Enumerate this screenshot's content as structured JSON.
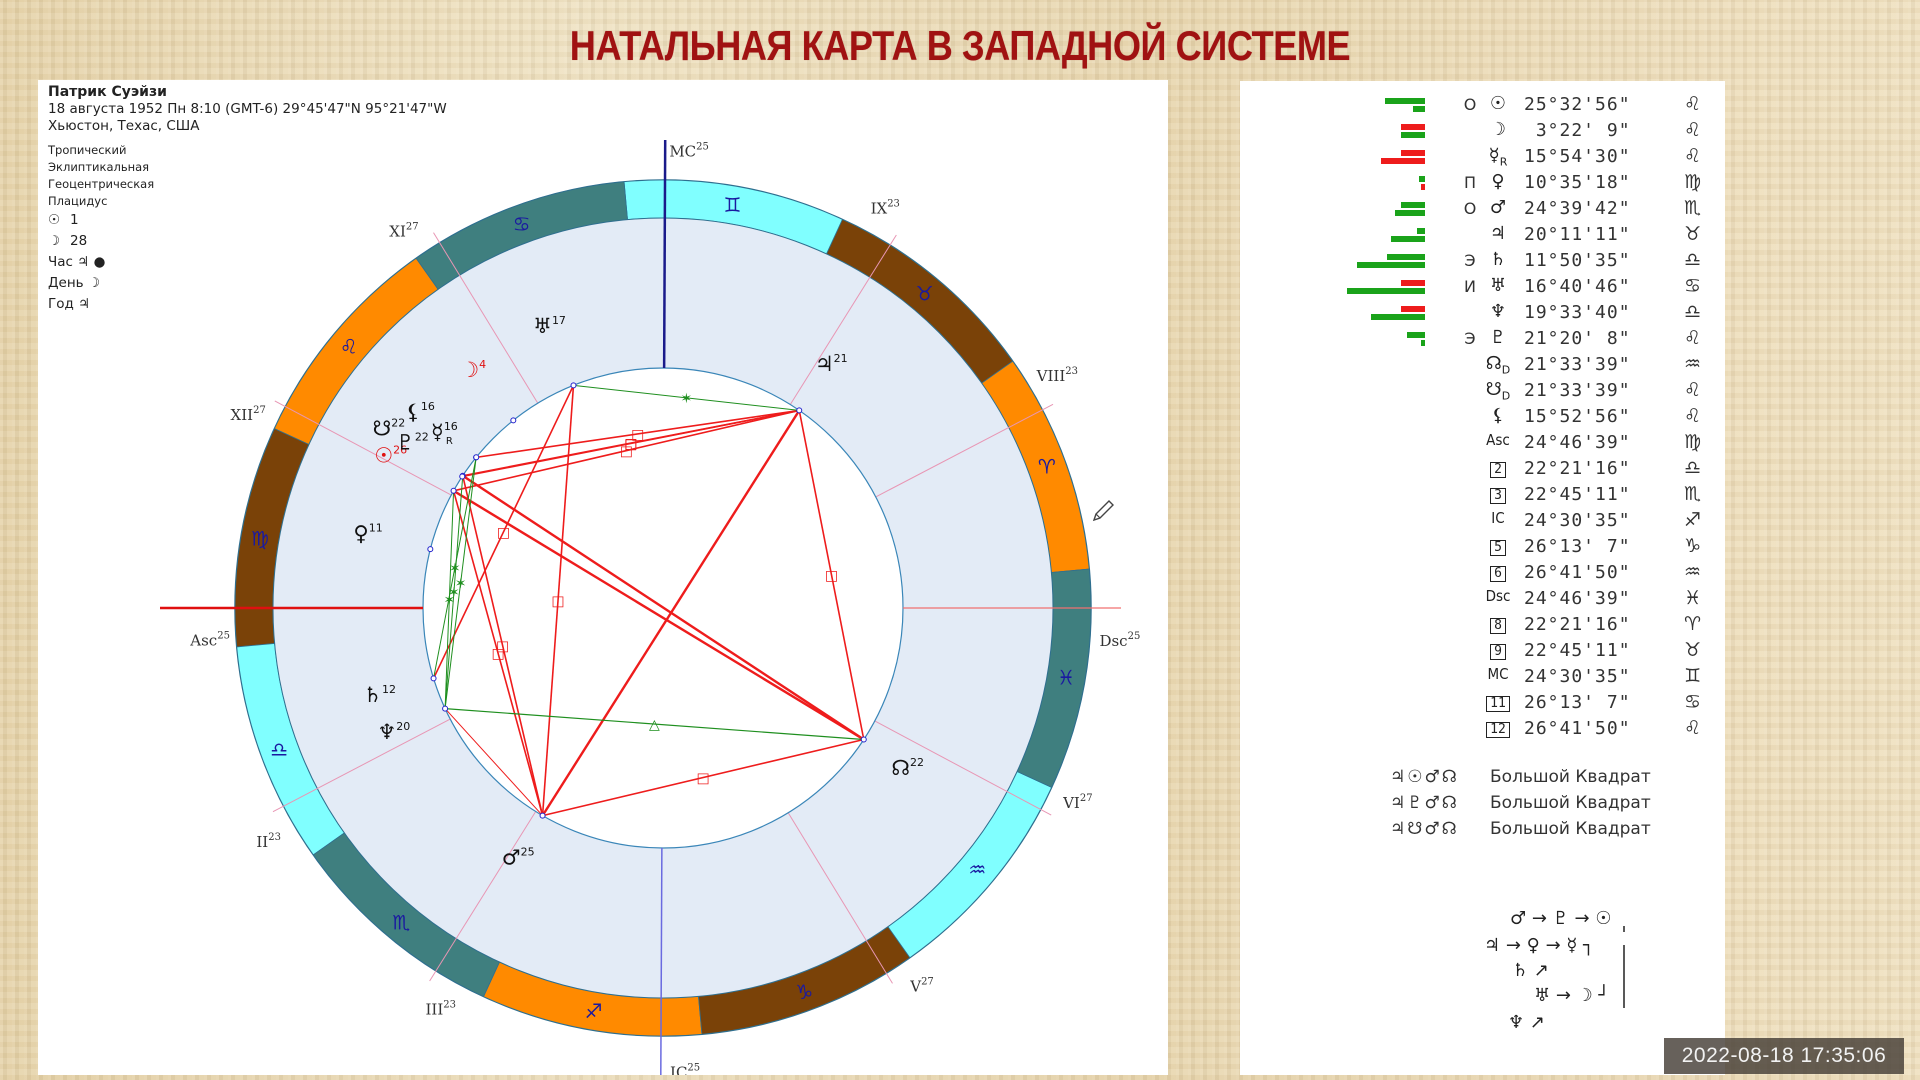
{
  "title": "НАТАЛЬНАЯ КАРТА В ЗАПАДНОЙ СИСТЕМЕ",
  "person": {
    "name": "Патрик Суэйзи",
    "birth_line": "18 августа 1952  Пн   8:10 (GMT-6) 29°45'47\"N  95°21'47\"W",
    "place": "Хьюстон, Техас, США"
  },
  "settings": [
    "Тропический",
    "Эклиптикальная",
    "Геоцентрическая",
    "Плацидус"
  ],
  "rulers": [
    {
      "glyph": "☉",
      "label": "",
      "value": "1"
    },
    {
      "glyph": "☽",
      "label": "",
      "value": "28"
    },
    {
      "glyph": "",
      "label": "Час",
      "value": "♃ ●"
    },
    {
      "glyph": "",
      "label": "День",
      "value": "☽"
    },
    {
      "glyph": "",
      "label": "Год",
      "value": "♃"
    }
  ],
  "colors": {
    "title": "#a01212",
    "fire": "#ff8a00",
    "earth": "#7a4208",
    "air": "#80ffff",
    "water": "#3f7f7f",
    "house_band": "#e3ebf6",
    "aspect_hard": "#ee1c1c",
    "aspect_soft": "#1f8f1f",
    "axis_mc": "#1a1a8a",
    "axis_asc": "#e01010",
    "cusp_line": "#e896b4",
    "bar_green": "#1aa31a",
    "bar_red": "#ee1c1c"
  },
  "chart_data": {
    "type": "natal-wheel",
    "ascendant_longitude": 174.78,
    "signs": [
      {
        "name": "Aries",
        "glyph": "♈",
        "element": "fire"
      },
      {
        "name": "Taurus",
        "glyph": "♉",
        "element": "earth"
      },
      {
        "name": "Gemini",
        "glyph": "♊",
        "element": "air"
      },
      {
        "name": "Cancer",
        "glyph": "♋",
        "element": "water"
      },
      {
        "name": "Leo",
        "glyph": "♌",
        "element": "fire"
      },
      {
        "name": "Virgo",
        "glyph": "♍",
        "element": "earth"
      },
      {
        "name": "Libra",
        "glyph": "♎",
        "element": "air"
      },
      {
        "name": "Scorpio",
        "glyph": "♏",
        "element": "water"
      },
      {
        "name": "Sagittarius",
        "glyph": "♐",
        "element": "fire"
      },
      {
        "name": "Capricorn",
        "glyph": "♑",
        "element": "earth"
      },
      {
        "name": "Aquarius",
        "glyph": "♒",
        "element": "air"
      },
      {
        "name": "Pisces",
        "glyph": "♓",
        "element": "water"
      }
    ],
    "houses": [
      {
        "label": "Asc",
        "degree": "25",
        "longitude": 174.78,
        "axis": true
      },
      {
        "label": "II",
        "degree": "23",
        "longitude": 202.35
      },
      {
        "label": "III",
        "degree": "23",
        "longitude": 232.75
      },
      {
        "label": "IC",
        "degree": "25",
        "longitude": 264.51,
        "axis": true
      },
      {
        "label": "V",
        "degree": "27",
        "longitude": 296.22
      },
      {
        "label": "VI",
        "degree": "27",
        "longitude": 326.7
      },
      {
        "label": "Dsc",
        "degree": "25",
        "longitude": 354.78,
        "axis": true
      },
      {
        "label": "VIII",
        "degree": "23",
        "longitude": 22.35
      },
      {
        "label": "IX",
        "degree": "23",
        "longitude": 52.75
      },
      {
        "label": "MC",
        "degree": "25",
        "longitude": 84.51,
        "axis": true
      },
      {
        "label": "XI",
        "degree": "27",
        "longitude": 116.22
      },
      {
        "label": "XII",
        "degree": "27",
        "longitude": 146.7
      }
    ],
    "planets": [
      {
        "name": "Sun",
        "glyph": "☉",
        "degree": "26",
        "longitude": 145.55,
        "color": "#e01010",
        "label_r": 0.8
      },
      {
        "name": "Moon",
        "glyph": "☽",
        "degree": "4",
        "longitude": 123.37,
        "color": "#e01010",
        "label_r": 0.78
      },
      {
        "name": "Mercury",
        "glyph": "☿",
        "degree": "16",
        "retro": "R",
        "longitude": 135.91,
        "color": "#111111",
        "label_r": 0.72
      },
      {
        "name": "Venus",
        "glyph": "♀",
        "degree": "11",
        "longitude": 160.59,
        "color": "#111111",
        "label_r": 0.78
      },
      {
        "name": "Mars",
        "glyph": "♂",
        "degree": "25",
        "longitude": 234.66,
        "color": "#111111",
        "label_r": 0.74
      },
      {
        "name": "Jupiter",
        "glyph": "♃",
        "degree": "21",
        "longitude": 50.19,
        "color": "#111111",
        "label_r": 0.76
      },
      {
        "name": "Saturn",
        "glyph": "♄",
        "degree": "12",
        "longitude": 191.84,
        "color": "#111111",
        "label_r": 0.76
      },
      {
        "name": "Uranus",
        "glyph": "♅",
        "degree": "17",
        "longitude": 106.68,
        "color": "#111111",
        "label_r": 0.78
      },
      {
        "name": "Neptune",
        "glyph": "♆",
        "degree": "20",
        "longitude": 199.56,
        "color": "#111111",
        "label_r": 0.76
      },
      {
        "name": "Pluto",
        "glyph": "♇",
        "degree": "22",
        "longitude": 141.34,
        "color": "#111111",
        "label_r": 0.77
      },
      {
        "name": "North Node",
        "glyph": "☊",
        "degree": "22",
        "longitude": 321.56,
        "color": "#111111",
        "label_r": 0.75
      },
      {
        "name": "South Node",
        "glyph": "☋",
        "degree": "22",
        "longitude": 141.56,
        "color": "#111111",
        "label_r": 0.84
      },
      {
        "name": "Lilith",
        "glyph": "⚸",
        "degree": "16",
        "longitude": 135.88,
        "color": "#111111",
        "label_r": 0.8
      }
    ],
    "aspects": [
      {
        "from": "Sun",
        "to": "Jupiter",
        "type": "square"
      },
      {
        "from": "Pluto",
        "to": "Jupiter",
        "type": "square"
      },
      {
        "from": "South Node",
        "to": "Jupiter",
        "type": "square"
      },
      {
        "from": "Mercury",
        "to": "Jupiter",
        "type": "square"
      },
      {
        "from": "Sun",
        "to": "North Node",
        "type": "opposition"
      },
      {
        "from": "Pluto",
        "to": "North Node",
        "type": "opposition"
      },
      {
        "from": "Jupiter",
        "to": "North Node",
        "type": "square"
      },
      {
        "from": "Jupiter",
        "to": "Mars",
        "type": "opposition"
      },
      {
        "from": "Mars",
        "to": "North Node",
        "type": "square"
      },
      {
        "from": "Sun",
        "to": "Mars",
        "type": "square"
      },
      {
        "from": "Pluto",
        "to": "Mars",
        "type": "square"
      },
      {
        "from": "Uranus",
        "to": "Mars",
        "type": "square"
      },
      {
        "from": "Uranus",
        "to": "Saturn",
        "type": "square"
      },
      {
        "from": "Uranus",
        "to": "Jupiter",
        "type": "sextile"
      },
      {
        "from": "Neptune",
        "to": "North Node",
        "type": "trine"
      },
      {
        "from": "Neptune",
        "to": "Sun",
        "type": "sextile"
      },
      {
        "from": "Neptune",
        "to": "Pluto",
        "type": "sextile"
      },
      {
        "from": "Saturn",
        "to": "Mercury",
        "type": "sextile"
      },
      {
        "from": "Neptune",
        "to": "Mercury",
        "type": "sextile"
      },
      {
        "from": "Neptune",
        "to": "Mars",
        "type": "semisquare"
      }
    ]
  },
  "planet_table": [
    {
      "glyph": "☉",
      "dignity": "О",
      "position": "25°32'56\"",
      "sign": "♌",
      "bars": [
        {
          "c": "g",
          "w": 40,
          "r": 1
        },
        {
          "c": "g",
          "w": 12,
          "r": 2
        }
      ]
    },
    {
      "glyph": "☽",
      "dignity": "",
      "position": " 3°22' 9\"",
      "sign": "♌",
      "bars": [
        {
          "c": "r",
          "w": 24,
          "r": 1
        },
        {
          "c": "g",
          "w": 24,
          "r": 2
        }
      ]
    },
    {
      "glyph": "☿",
      "sub": "R",
      "dignity": "",
      "position": "15°54'30\"",
      "sign": "♌",
      "bars": [
        {
          "c": "r",
          "w": 24,
          "r": 1
        },
        {
          "c": "r",
          "w": 44,
          "r": 2
        }
      ]
    },
    {
      "glyph": "♀",
      "dignity": "П",
      "position": "10°35'18\"",
      "sign": "♍",
      "bars": [
        {
          "c": "g",
          "w": 6,
          "r": 1
        },
        {
          "c": "r",
          "w": 4,
          "r": 2
        }
      ]
    },
    {
      "glyph": "♂",
      "dignity": "О",
      "position": "24°39'42\"",
      "sign": "♏",
      "bars": [
        {
          "c": "g",
          "w": 24,
          "r": 1
        },
        {
          "c": "g",
          "w": 30,
          "r": 2
        }
      ]
    },
    {
      "glyph": "♃",
      "dignity": "",
      "position": "20°11'11\"",
      "sign": "♉",
      "bars": [
        {
          "c": "g",
          "w": 8,
          "r": 1
        },
        {
          "c": "g",
          "w": 34,
          "r": 2
        }
      ]
    },
    {
      "glyph": "♄",
      "dignity": "Э",
      "position": "11°50'35\"",
      "sign": "♎",
      "bars": [
        {
          "c": "g",
          "w": 38,
          "r": 1
        },
        {
          "c": "g",
          "w": 68,
          "r": 2
        }
      ]
    },
    {
      "glyph": "♅",
      "dignity": "И",
      "position": "16°40'46\"",
      "sign": "♋",
      "bars": [
        {
          "c": "r",
          "w": 24,
          "r": 1
        },
        {
          "c": "g",
          "w": 78,
          "r": 2
        }
      ]
    },
    {
      "glyph": "♆",
      "dignity": "",
      "position": "19°33'40\"",
      "sign": "♎",
      "bars": [
        {
          "c": "r",
          "w": 24,
          "r": 1
        },
        {
          "c": "g",
          "w": 54,
          "r": 2
        }
      ]
    },
    {
      "glyph": "♇",
      "dignity": "Э",
      "position": "21°20' 8\"",
      "sign": "♌",
      "bars": [
        {
          "c": "g",
          "w": 18,
          "r": 1
        },
        {
          "c": "g",
          "w": 4,
          "r": 2
        }
      ]
    },
    {
      "glyph": "☊",
      "sub": "D",
      "dignity": "",
      "position": "21°33'39\"",
      "sign": "♒",
      "bars": []
    },
    {
      "glyph": "☋",
      "sub": "D",
      "dignity": "",
      "position": "21°33'39\"",
      "sign": "♌",
      "bars": []
    },
    {
      "glyph": "⚸",
      "dignity": "",
      "position": "15°52'56\"",
      "sign": "♌",
      "bars": []
    },
    {
      "glyph": "Asc",
      "dignity": "",
      "position": "24°46'39\"",
      "sign": "♍",
      "bars": []
    },
    {
      "box": "2",
      "dignity": "",
      "position": "22°21'16\"",
      "sign": "♎",
      "bars": []
    },
    {
      "box": "3",
      "dignity": "",
      "position": "22°45'11\"",
      "sign": "♏",
      "bars": []
    },
    {
      "glyph": "IC",
      "dignity": "",
      "position": "24°30'35\"",
      "sign": "♐",
      "bars": []
    },
    {
      "box": "5",
      "dignity": "",
      "position": "26°13' 7\"",
      "sign": "♑",
      "bars": []
    },
    {
      "box": "6",
      "dignity": "",
      "position": "26°41'50\"",
      "sign": "♒",
      "bars": []
    },
    {
      "glyph": "Dsc",
      "dignity": "",
      "position": "24°46'39\"",
      "sign": "♓",
      "bars": []
    },
    {
      "box": "8",
      "dignity": "",
      "position": "22°21'16\"",
      "sign": "♈",
      "bars": []
    },
    {
      "box": "9",
      "dignity": "",
      "position": "22°45'11\"",
      "sign": "♉",
      "bars": []
    },
    {
      "glyph": "MC",
      "dignity": "",
      "position": "24°30'35\"",
      "sign": "♊",
      "bars": []
    },
    {
      "box": "11",
      "dignity": "",
      "position": "26°13' 7\"",
      "sign": "♋",
      "bars": []
    },
    {
      "box": "12",
      "dignity": "",
      "position": "26°41'50\"",
      "sign": "♌",
      "bars": []
    }
  ],
  "configurations": [
    {
      "glyphs": "♃☉♂☊",
      "label": "Большой Квадрат"
    },
    {
      "glyphs": "♃♇♂☊",
      "label": "Большой Квадрат"
    },
    {
      "glyphs": "♃☋♂☊",
      "label": "Большой Квадрат"
    }
  ],
  "dispositor_tree": {
    "rows": [
      {
        "text": "♂ → ♇ → ☉"
      },
      {
        "text": "♃ → ♀ → ☿ ┐"
      },
      {
        "text": "♄ ↗"
      },
      {
        "text": "♅ → ☽ ┘"
      },
      {
        "text": "♆ ↗"
      }
    ]
  },
  "timestamp": "2022-08-18 17:35:06"
}
